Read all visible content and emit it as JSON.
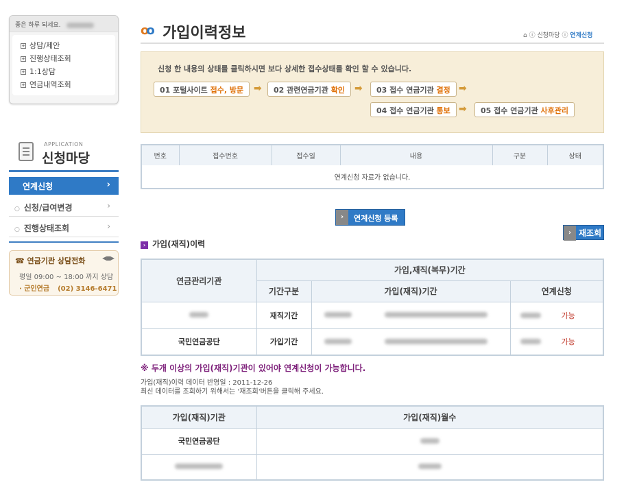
{
  "userbox": {
    "greeting": "좋은 하루 되세요.",
    "menu": [
      "상담/제안",
      "진행상태조회",
      "1:1상담",
      "연금내역조회"
    ]
  },
  "sidebar": {
    "eng_label": "APPLICATION",
    "title": "신청마당",
    "active": "연계신청",
    "items": [
      "신청/급여변경",
      "진행상태조회"
    ]
  },
  "phone": {
    "title": "연금기관 상담전화",
    "hours": "평일 09:00 ~ 18:00 까지 상담",
    "org": "· 군인연금",
    "number": "(02) 3146-6471"
  },
  "header": {
    "title": "가입이력정보",
    "crumb_home": "⌂",
    "crumb_1": "신청마당",
    "crumb_2": "연계신청"
  },
  "process": {
    "info": "신청 한 내용의 상태를 클릭하시면 보다 상세한 접수상태를 확인 할 수 있습니다.",
    "steps": [
      {
        "pre": "01  포털사이트 ",
        "em": "접수, 방문"
      },
      {
        "pre": "02  관련연금기관 ",
        "em": "확인"
      },
      {
        "pre": "03  접수 연금기관 ",
        "em": "결정"
      },
      {
        "pre": "04  접수 연금기관 ",
        "em": "통보"
      },
      {
        "pre": "05  접수 연금기관 ",
        "em": "사후관리"
      }
    ]
  },
  "table1": {
    "headers": [
      "번호",
      "접수번호",
      "접수일",
      "내용",
      "구분",
      "상태"
    ],
    "empty": "연계신청 자료가 없습니다."
  },
  "buttons": {
    "register": "연계신청 등록",
    "reload": "재조회"
  },
  "history": {
    "title": "가입(재직)이력",
    "h_org": "연금관리기관",
    "h_period": "가입,재직(복무)기간",
    "h_type": "기간구분",
    "h_range": "가입(재직)기간",
    "h_link": "연계신청",
    "rows": [
      {
        "org": "",
        "type": "재직기간",
        "status": "가능"
      },
      {
        "org": "국민연금공단",
        "type": "가입기간",
        "status": "가능"
      }
    ]
  },
  "notice": "※ 두개 이상의 가입(재직)기관이 있어야 연계신청이 가능합니다.",
  "note1": "가입(재직)이력 데이터 반영일 : 2011-12-26",
  "note2": "최신 데이터를 조회하기 위해서는 '재조회'버튼을 클릭해 주세요.",
  "table3": {
    "headers": [
      "가입(재직)기관",
      "가입(재직)월수"
    ],
    "rows": [
      {
        "org": "국민연금공단"
      },
      {
        "org": ""
      }
    ]
  },
  "colors": {
    "accent": "#2f7ac6",
    "orange": "#e0720a",
    "purple": "#7d2fa8"
  }
}
